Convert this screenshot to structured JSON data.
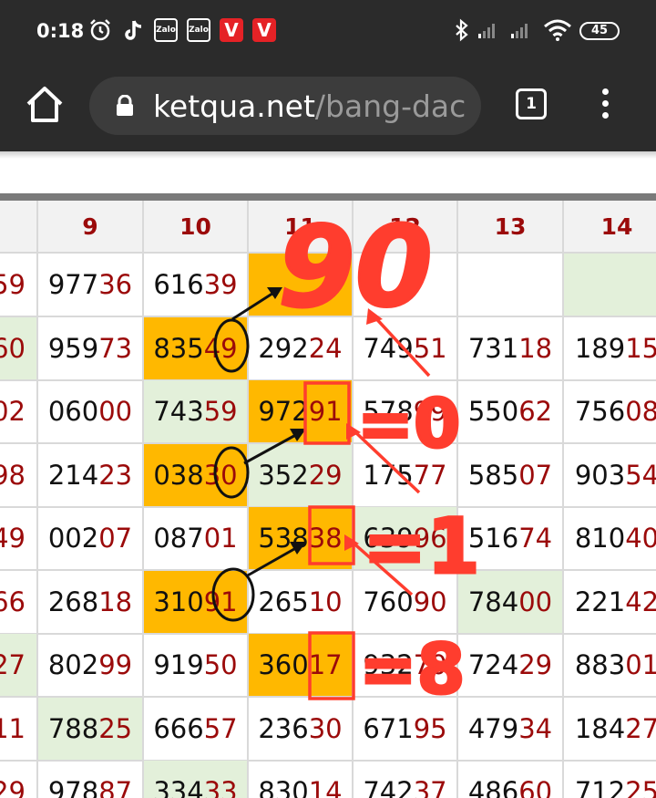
{
  "status_bar": {
    "time": "0:18",
    "zalo_label": "Zalo",
    "v_label": "V",
    "battery": "45"
  },
  "browser": {
    "url_host": "ketqua.net",
    "url_path": "/bang-dac",
    "tab_count": "1"
  },
  "table": {
    "headers": [
      "",
      "9",
      "10",
      "11",
      "12",
      "13",
      "14"
    ],
    "rows": [
      [
        {
          "d": "",
          "r": "59",
          "bg": ""
        },
        {
          "d": "977",
          "r": "36",
          "bg": ""
        },
        {
          "d": "616",
          "r": "39",
          "bg": ""
        },
        {
          "d": "",
          "r": "",
          "bg": "o"
        },
        {
          "d": "",
          "r": "",
          "bg": ""
        },
        {
          "d": "",
          "r": "",
          "bg": ""
        },
        {
          "d": "",
          "r": "",
          "bg": "g"
        }
      ],
      [
        {
          "d": "",
          "r": "60",
          "bg": "g"
        },
        {
          "d": "959",
          "r": "73",
          "bg": ""
        },
        {
          "d": "835",
          "r": "49",
          "bg": "o"
        },
        {
          "d": "292",
          "r": "24",
          "bg": ""
        },
        {
          "d": "749",
          "r": "51",
          "bg": ""
        },
        {
          "d": "731",
          "r": "18",
          "bg": ""
        },
        {
          "d": "189",
          "r": "15",
          "bg": ""
        }
      ],
      [
        {
          "d": "",
          "r": "02",
          "bg": ""
        },
        {
          "d": "060",
          "r": "00",
          "bg": ""
        },
        {
          "d": "743",
          "r": "59",
          "bg": "g"
        },
        {
          "d": "972",
          "r": "91",
          "bg": "o"
        },
        {
          "d": "578",
          "r": "99",
          "bg": ""
        },
        {
          "d": "550",
          "r": "62",
          "bg": ""
        },
        {
          "d": "756",
          "r": "08",
          "bg": ""
        }
      ],
      [
        {
          "d": "",
          "r": "98",
          "bg": ""
        },
        {
          "d": "214",
          "r": "23",
          "bg": ""
        },
        {
          "d": "038",
          "r": "30",
          "bg": "o"
        },
        {
          "d": "352",
          "r": "29",
          "bg": "g"
        },
        {
          "d": "175",
          "r": "77",
          "bg": ""
        },
        {
          "d": "585",
          "r": "07",
          "bg": ""
        },
        {
          "d": "903",
          "r": "54",
          "bg": ""
        }
      ],
      [
        {
          "d": "",
          "r": "49",
          "bg": ""
        },
        {
          "d": "002",
          "r": "07",
          "bg": ""
        },
        {
          "d": "087",
          "r": "01",
          "bg": ""
        },
        {
          "d": "538",
          "r": "38",
          "bg": "o"
        },
        {
          "d": "639",
          "r": "96",
          "bg": "g"
        },
        {
          "d": "516",
          "r": "74",
          "bg": ""
        },
        {
          "d": "810",
          "r": "40",
          "bg": ""
        }
      ],
      [
        {
          "d": "",
          "r": "66",
          "bg": ""
        },
        {
          "d": "268",
          "r": "18",
          "bg": ""
        },
        {
          "d": "310",
          "r": "91",
          "bg": "o"
        },
        {
          "d": "265",
          "r": "10",
          "bg": ""
        },
        {
          "d": "760",
          "r": "90",
          "bg": ""
        },
        {
          "d": "784",
          "r": "00",
          "bg": "g"
        },
        {
          "d": "221",
          "r": "42",
          "bg": ""
        }
      ],
      [
        {
          "d": "",
          "r": "27",
          "bg": "g"
        },
        {
          "d": "802",
          "r": "99",
          "bg": ""
        },
        {
          "d": "919",
          "r": "50",
          "bg": ""
        },
        {
          "d": "360",
          "r": "17",
          "bg": "o"
        },
        {
          "d": "932",
          "r": "70",
          "bg": ""
        },
        {
          "d": "724",
          "r": "29",
          "bg": ""
        },
        {
          "d": "883",
          "r": "01",
          "bg": ""
        }
      ],
      [
        {
          "d": "",
          "r": "11",
          "bg": ""
        },
        {
          "d": "788",
          "r": "25",
          "bg": "g"
        },
        {
          "d": "666",
          "r": "57",
          "bg": ""
        },
        {
          "d": "236",
          "r": "30",
          "bg": ""
        },
        {
          "d": "671",
          "r": "95",
          "bg": ""
        },
        {
          "d": "479",
          "r": "34",
          "bg": ""
        },
        {
          "d": "184",
          "r": "27",
          "bg": ""
        }
      ],
      [
        {
          "d": "",
          "r": "29",
          "bg": ""
        },
        {
          "d": "978",
          "r": "87",
          "bg": ""
        },
        {
          "d": "334",
          "r": "33",
          "bg": "g"
        },
        {
          "d": "830",
          "r": "14",
          "bg": ""
        },
        {
          "d": "742",
          "r": "37",
          "bg": ""
        },
        {
          "d": "486",
          "r": "60",
          "bg": ""
        },
        {
          "d": "712",
          "r": "25",
          "bg": ""
        }
      ]
    ]
  },
  "annotations": {
    "big_number": "90",
    "eq_0": "=0",
    "eq_1": "=1",
    "eq_8": "=8"
  },
  "colors": {
    "highlight_orange": "#ffb800",
    "highlight_green": "#e3f0da",
    "digit_red": "#9b0a0a",
    "annotation_red": "#ff3d2e"
  }
}
